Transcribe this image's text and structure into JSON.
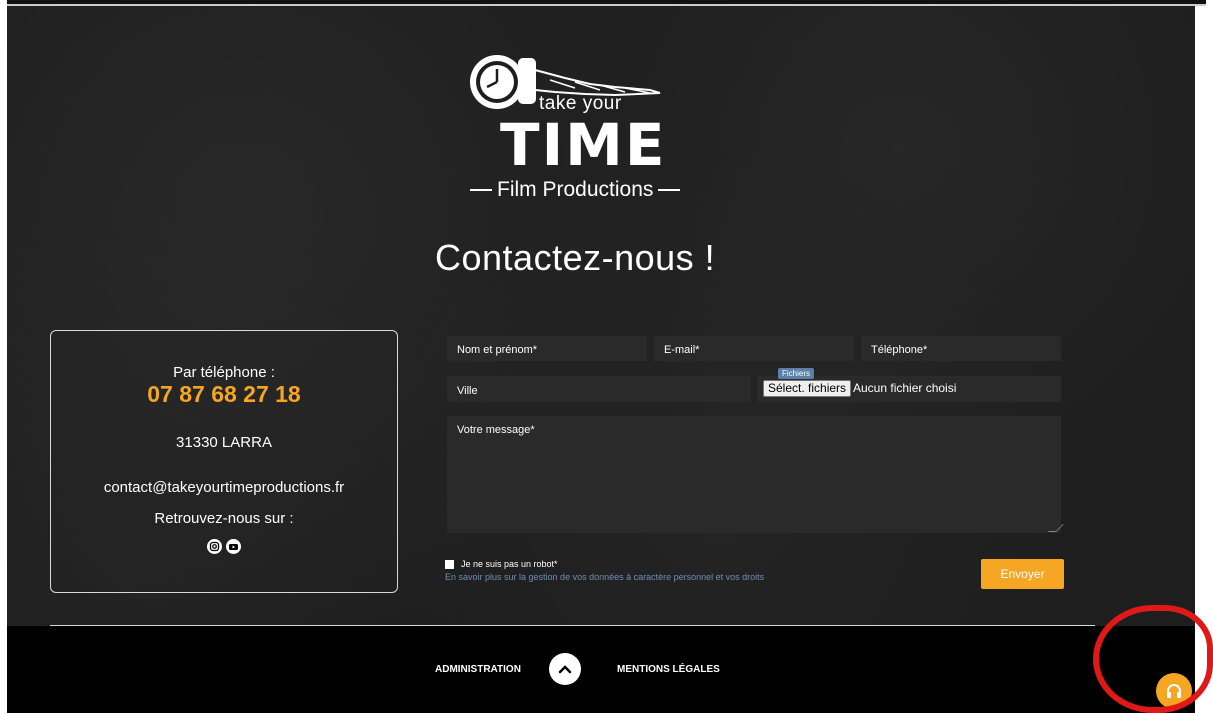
{
  "logo": {
    "small_text": "take your",
    "big_text": "TIME",
    "sub_text": "Film Productions"
  },
  "page_title": "Contactez-nous !",
  "contact": {
    "phone_label": "Par téléphone :",
    "phone": "07 87 68 27 18",
    "city": "31330 LARRA",
    "email": "contact@takeyourtimeproductions.fr",
    "follow_label": "Retrouvez-nous sur :",
    "socials": [
      "instagram-icon",
      "youtube-icon"
    ]
  },
  "form": {
    "name_placeholder": "Nom et prénom*",
    "email_placeholder": "E-mail*",
    "phone_placeholder": "Téléphone*",
    "city_placeholder": "Ville",
    "file_tag": "Fichiers",
    "file_button": "Sélect. fichiers",
    "file_status": "Aucun fichier choisi",
    "message_placeholder": "Votre message*",
    "robot_label": "Je ne suis pas un robot*",
    "privacy_link": "En savoir plus sur la gestion de vos données à caractère personnel et vos droits",
    "submit_label": "Envoyer"
  },
  "footer": {
    "admin_link": "ADMINISTRATION",
    "legal_link": "MENTIONS LÉGALES"
  },
  "colors": {
    "accent": "#f5a623",
    "background": "#1e1e1e",
    "footer": "#000000",
    "annotation": "#e01818"
  }
}
